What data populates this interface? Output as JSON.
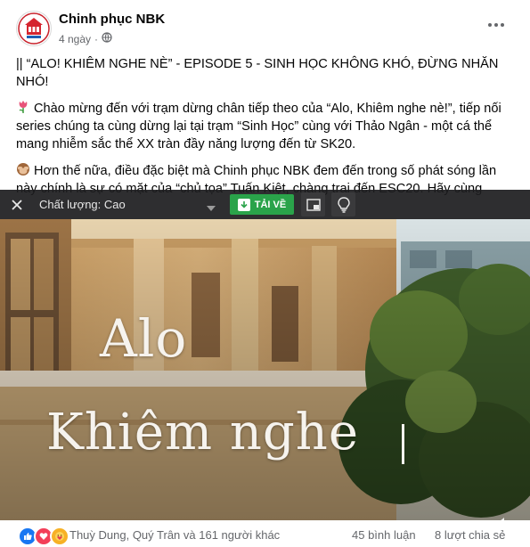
{
  "post": {
    "page_name": "Chinh phục NBK",
    "time": "4 ngày",
    "separator": "·",
    "privacy_icon": "globe-icon",
    "paragraphs": {
      "p1": "|| “ALO! KHIÊM NGHE NÈ” - EPISODE 5 - SINH HỌC KHÔNG KHÓ, ĐỪNG NHĂN NHÓ!",
      "p2": "Chào mừng đến với trạm dừng chân tiếp theo của “Alo, Khiêm nghe nè!”, tiếp nối series chúng ta cùng dừng lại tại trạm “Sinh Học” cùng với Thảo Ngân - một cá thể mang nhiễm sắc thể XX tràn đầy năng lượng đến từ SK20.",
      "p3": "Hơn thế nữa, điều đặc biệt mà Chinh phục NBK đem đến trong số phát sóng lần này chính là sự có mặt của “chủ tọa” Tuấn Kiệt, chàng trai đến ESC20. Hãy cùng"
    },
    "emoji_p2": "tulip-emoji",
    "emoji_p3": "see-no-evil-monkey-emoji"
  },
  "video_toolbar": {
    "quality_label": "Chất lượng: Cao",
    "download_label": "TẢI VỀ",
    "accent_color": "#2aa34a"
  },
  "video": {
    "title_line1": "Alo",
    "title_line2": "Khiêm nghe"
  },
  "footer": {
    "reactors": "Thuỳ Dung, Quý Trân và 161 người khác",
    "comments": "45 bình luận",
    "shares": "8 lượt chia sẻ",
    "reaction_icons": [
      "like-reaction",
      "love-reaction",
      "care-reaction"
    ]
  }
}
